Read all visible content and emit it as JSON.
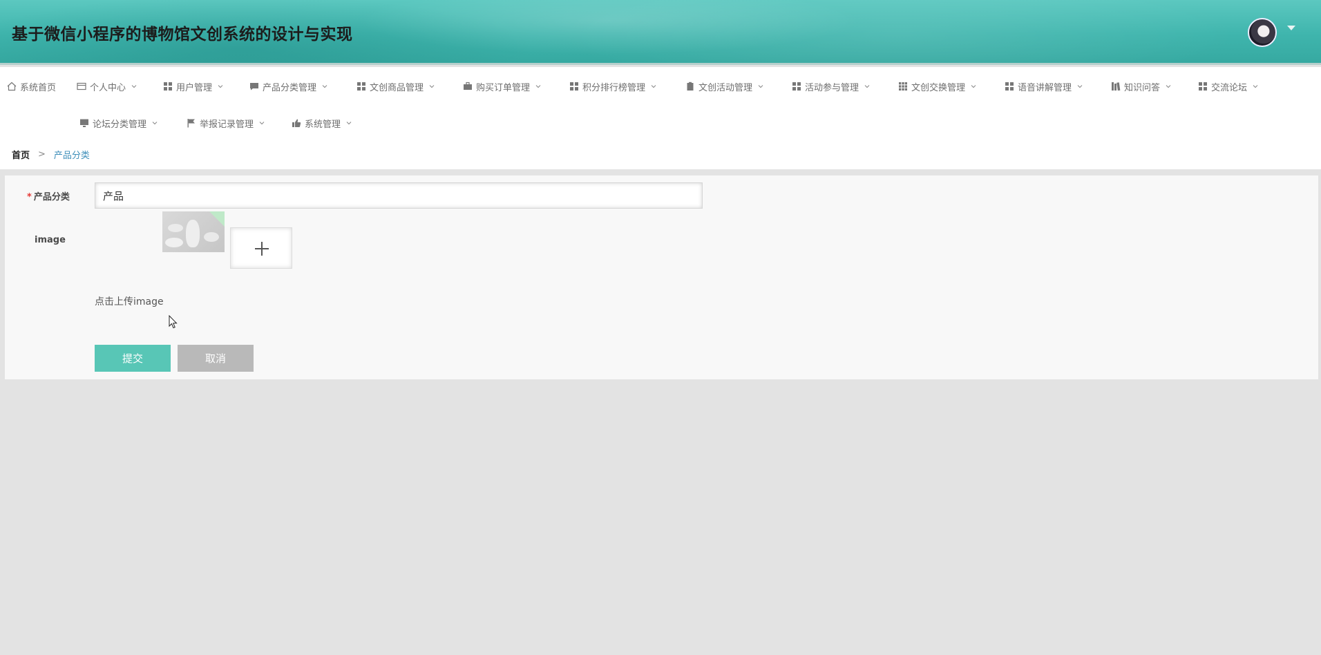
{
  "header": {
    "title": "基于微信小程序的博物馆文创系统的设计与实现"
  },
  "nav": {
    "items": [
      {
        "label": "系统首页",
        "icon": "home-icon"
      },
      {
        "label": "个人中心",
        "icon": "card-icon"
      },
      {
        "label": "用户管理",
        "icon": "grid-icon"
      },
      {
        "label": "产品分类管理",
        "icon": "chat-icon"
      },
      {
        "label": "文创商品管理",
        "icon": "grid-icon"
      },
      {
        "label": "购买订单管理",
        "icon": "briefcase-icon"
      },
      {
        "label": "积分排行榜管理",
        "icon": "grid-icon"
      },
      {
        "label": "文创活动管理",
        "icon": "clipboard-icon"
      },
      {
        "label": "活动参与管理",
        "icon": "grid-icon"
      },
      {
        "label": "文创交换管理",
        "icon": "table-icon"
      },
      {
        "label": "语音讲解管理",
        "icon": "grid-icon"
      },
      {
        "label": "知识问答",
        "icon": "books-icon"
      },
      {
        "label": "交流论坛",
        "icon": "grid-icon"
      },
      {
        "label": "论坛分类管理",
        "icon": "monitor-icon"
      },
      {
        "label": "举报记录管理",
        "icon": "flag-icon"
      },
      {
        "label": "系统管理",
        "icon": "thumb-icon"
      }
    ]
  },
  "breadcrumb": {
    "home": "首页",
    "separator": ">",
    "current": "产品分类"
  },
  "form": {
    "required_mark": "*",
    "category_label": "产品分类",
    "category_value": "产品",
    "image_label": "image",
    "upload_hint": "点击上传image",
    "submit_label": "提交",
    "cancel_label": "取消"
  },
  "colors": {
    "header_teal": "#3fb5ad",
    "submit": "#58c6b6",
    "cancel": "#b9b9b9",
    "breadcrumb_current": "#3d8eb9",
    "required": "#e53935"
  }
}
